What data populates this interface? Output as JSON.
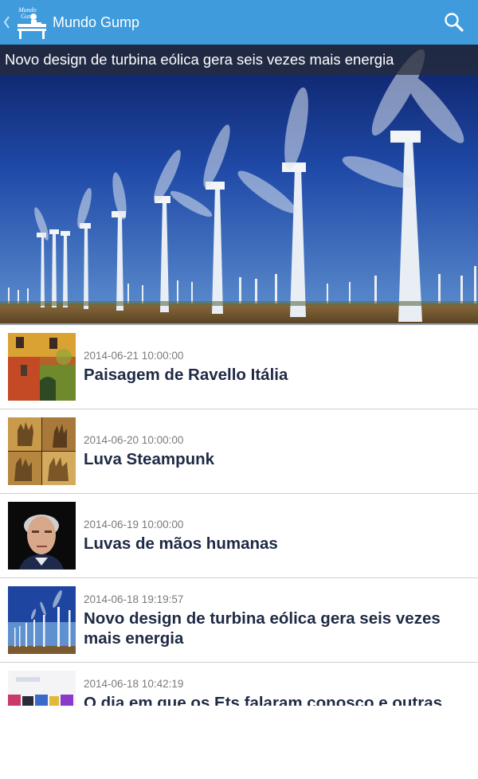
{
  "actionbar": {
    "title": "Mundo Gump",
    "logo_text": "Mundo Gump",
    "up_icon": "chevron-left-icon",
    "search_icon": "search-icon",
    "color": "#3f9bdc"
  },
  "featured": {
    "title": "Novo design de turbina eólica gera seis vezes mais energia",
    "image": "wind-turbines-photo"
  },
  "articles": [
    {
      "date": "2014-06-21 10:00:00",
      "title": "Paisagem de Ravello Itália",
      "thumb": "ivy-covered-building-photo"
    },
    {
      "date": "2014-06-20 10:00:00",
      "title": "Luva Steampunk",
      "thumb": "steampunk-glove-photo"
    },
    {
      "date": "2014-06-19 10:00:00",
      "title": "Luvas de mãos humanas",
      "thumb": "man-portrait-photo"
    },
    {
      "date": "2014-06-18 19:19:57",
      "title": "Novo design de turbina eólica gera seis vezes mais energia",
      "thumb": "wind-turbines-photo"
    },
    {
      "date": "2014-06-18 10:42:19",
      "title": "O dia em que os Ets falaram conosco e outras",
      "thumb": "colorful-letters-photo"
    }
  ]
}
